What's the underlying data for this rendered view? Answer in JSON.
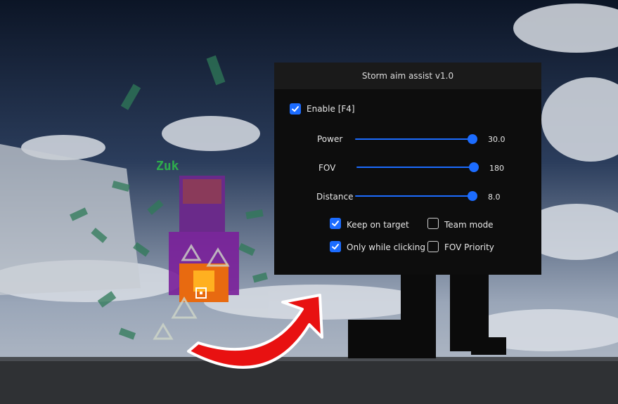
{
  "window": {
    "title": "Storm aim assist v1.0"
  },
  "enable": {
    "label": "Enable [F4]",
    "checked": true
  },
  "sliders": [
    {
      "label": "Power",
      "value": "30.0",
      "fraction": 1.0
    },
    {
      "label": "FOV",
      "value": "180",
      "fraction": 1.0
    },
    {
      "label": "Distance",
      "value": "8.0",
      "fraction": 1.0
    }
  ],
  "options": {
    "keep_on_target": {
      "label": "Keep on target",
      "checked": true
    },
    "team_mode": {
      "label": "Team mode",
      "checked": false
    },
    "only_while_clicking": {
      "label": "Only while clicking",
      "checked": true
    },
    "fov_priority": {
      "label": "FOV Priority",
      "checked": false
    }
  },
  "scene": {
    "nametag": "Zuk"
  },
  "colors": {
    "accent": "#1c6cff",
    "panel": "#0d0d0d",
    "arrow": "#e81111"
  }
}
